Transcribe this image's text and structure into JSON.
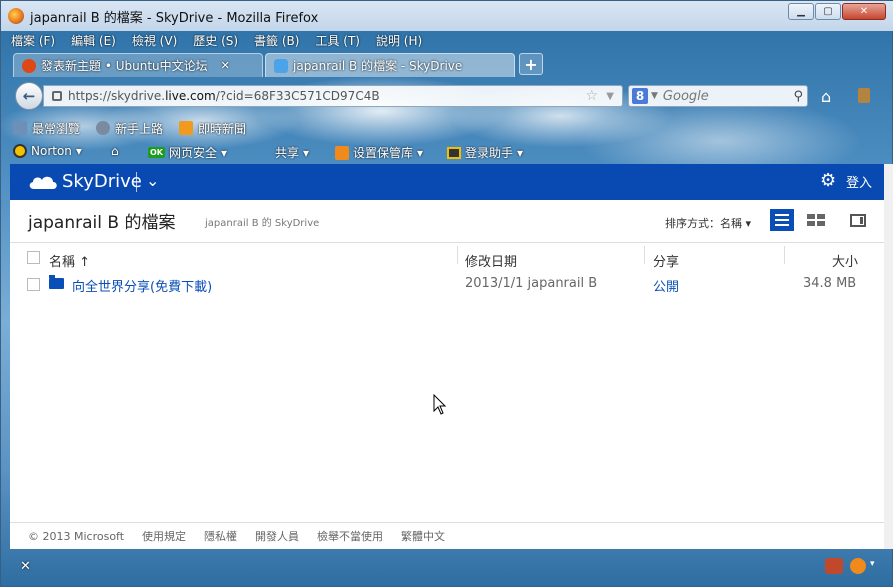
{
  "window": {
    "title": "japanrail B 的檔案 - SkyDrive - Mozilla Firefox",
    "min_label": "▁",
    "max_label": "▢",
    "close_label": "✕"
  },
  "menu": [
    "檔案 (F)",
    "編輯 (E)",
    "檢視 (V)",
    "歷史 (S)",
    "書籤 (B)",
    "工具 (T)",
    "說明 (H)"
  ],
  "tabs": [
    {
      "label": "發表新主題 • Ubuntu中文论坛",
      "close": "✕"
    },
    {
      "label": "japanrail B 的檔案 - SkyDrive",
      "close": ""
    }
  ],
  "newtab_label": "+",
  "urlbar": {
    "prefix": "https://skydrive.",
    "domain": "live.com",
    "suffix": "/?cid=68F33C571CD97C4B"
  },
  "searchbar": {
    "engine": "8",
    "placeholder": "Google"
  },
  "bookmarks": [
    "最常瀏覽",
    "新手上路",
    "即時新聞"
  ],
  "toolbar2": {
    "norton": "Norton",
    "web_safety": "网页安全",
    "share": "共享",
    "vault": "设置保管库",
    "login_helper": "登录助手"
  },
  "skydrive": {
    "brand": "SkyDrive",
    "signin": "登入",
    "page_title": "japanrail B 的檔案",
    "page_subtitle": "japanrail B 的 SkyDrive",
    "sort_label": "排序方式：名稱 ▾"
  },
  "columns": {
    "name": "名稱 ↑",
    "modified": "修改日期",
    "sharing": "分享",
    "size": "大小"
  },
  "rows": [
    {
      "name": "向全世界分享(免費下載)",
      "modified": "2013/1/1  japanrail B",
      "sharing": "公開",
      "size": "34.8 MB"
    }
  ],
  "footer": [
    "© 2013 Microsoft",
    "使用規定",
    "隱私權",
    "開發人員",
    "檢舉不當使用",
    "繁體中文"
  ],
  "status": {
    "close_label": "✕"
  },
  "colors": {
    "skydrive_blue": "#094ab2",
    "link_blue": "#0a4fb8"
  }
}
